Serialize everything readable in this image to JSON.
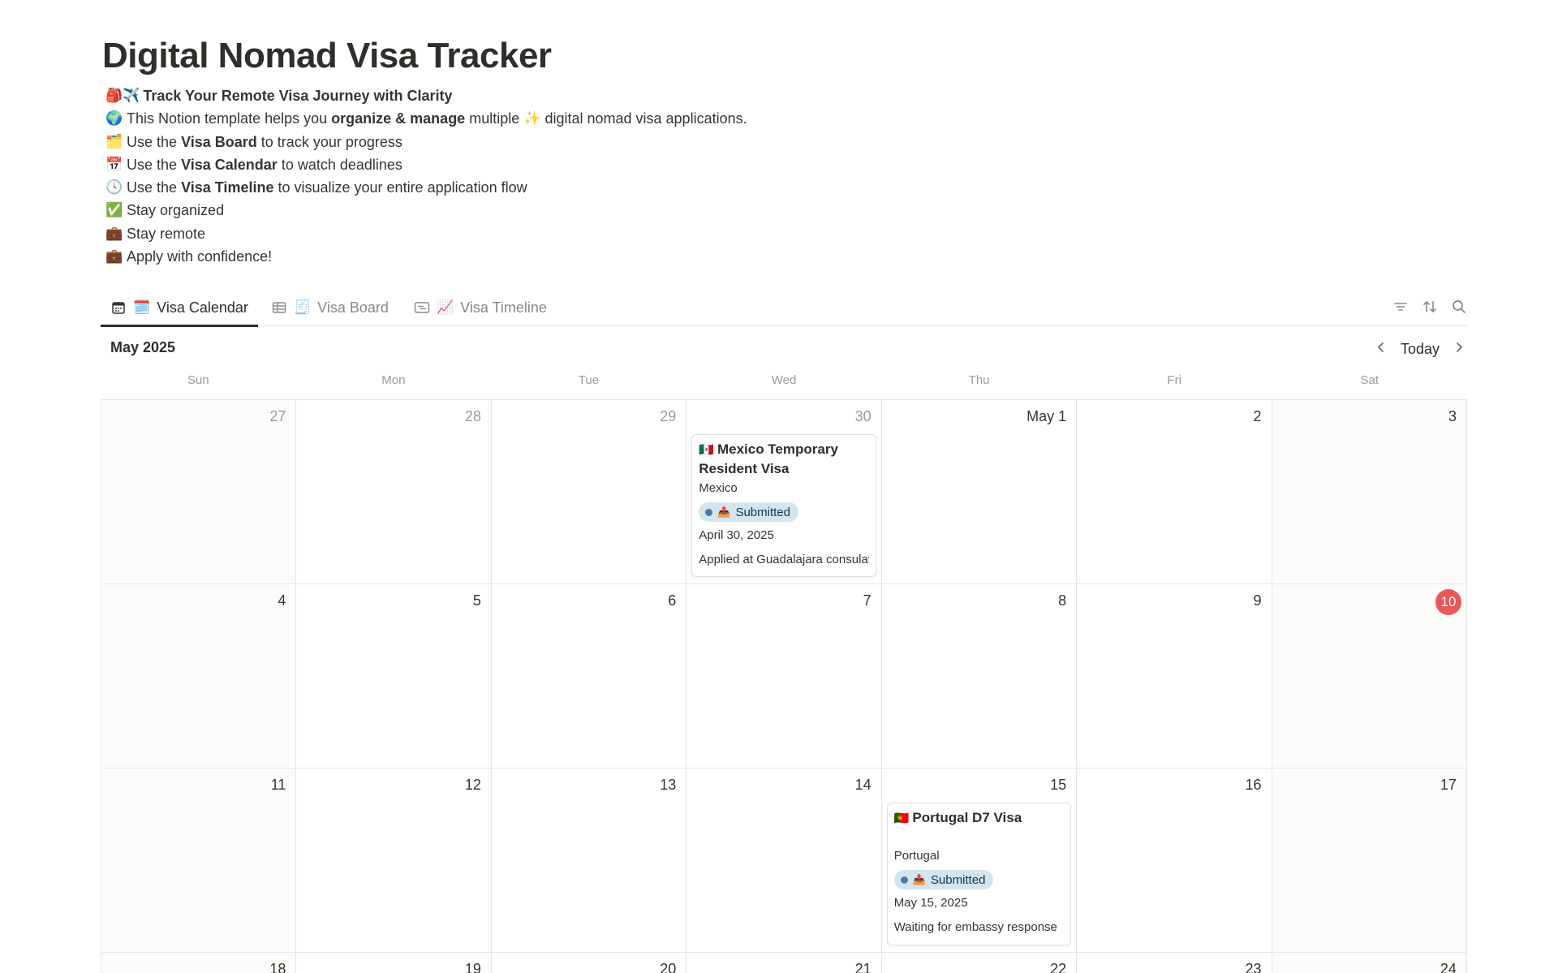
{
  "page": {
    "title": "Digital Nomad Visa Tracker",
    "intro": {
      "line1": {
        "emoji": "🎒✈️",
        "bold": "Track Your Remote Visa Journey with Clarity"
      },
      "line2": {
        "emoji": "🌍",
        "pre": "This Notion template helps you",
        "bold": "organize & manage",
        "mid": "multiple",
        "sparkle": "✨",
        "post": "digital nomad visa applications."
      },
      "line3": {
        "emoji": "🗂️",
        "pre": "Use the",
        "bold": "Visa Board",
        "post": "to track your progress"
      },
      "line4": {
        "emoji": "📅",
        "pre": "Use the",
        "bold": "Visa Calendar",
        "post": "to watch deadlines"
      },
      "line5": {
        "emoji": "🕓",
        "pre": "Use the",
        "bold": "Visa Timeline",
        "post": "to visualize your entire application flow"
      },
      "line6": {
        "emoji": "✅",
        "text": "Stay organized"
      },
      "line7": {
        "emoji": "💼",
        "text": "Stay remote"
      },
      "line8": {
        "emoji": "💼",
        "text": "Apply with confidence!"
      }
    }
  },
  "tabs": [
    {
      "emoji": "🗓️",
      "label": "Visa Calendar",
      "icon": "calendar-icon",
      "active": true
    },
    {
      "emoji": "🧾",
      "label": "Visa Board",
      "icon": "table-icon",
      "active": false
    },
    {
      "emoji": "📈",
      "label": "Visa Timeline",
      "icon": "timeline-icon",
      "active": false
    }
  ],
  "toolbar": {
    "icons": [
      "filter-icon",
      "sort-icon",
      "search-icon"
    ]
  },
  "calendar": {
    "month_label": "May 2025",
    "today_label": "Today",
    "weekdays": [
      "Sun",
      "Mon",
      "Tue",
      "Wed",
      "Thu",
      "Fri",
      "Sat"
    ],
    "weeks": [
      [
        "27",
        "28",
        "29",
        "30",
        "May 1",
        "2",
        "3"
      ],
      [
        "4",
        "5",
        "6",
        "7",
        "8",
        "9",
        "10"
      ],
      [
        "11",
        "12",
        "13",
        "14",
        "15",
        "16",
        "17"
      ],
      [
        "18",
        "19",
        "20",
        "21",
        "22",
        "23",
        "24"
      ]
    ],
    "today_date": "10",
    "events": {
      "mexico": {
        "flag": "🇲🇽",
        "title": "Mexico Temporary Resident Visa",
        "country": "Mexico",
        "status_emoji": "📤",
        "status": "Submitted",
        "date": "April 30, 2025",
        "note": "Applied at Guadalajara consulate"
      },
      "portugal": {
        "flag": "🇵🇹",
        "title": "Portugal D7 Visa",
        "country": "Portugal",
        "status_emoji": "📤",
        "status": "Submitted",
        "date": "May 15, 2025",
        "note": "Waiting for embassy response"
      }
    }
  },
  "colors": {
    "accent_today": "#eb5757",
    "status_bg": "#d3e5ef",
    "status_dot": "#487ca5"
  }
}
